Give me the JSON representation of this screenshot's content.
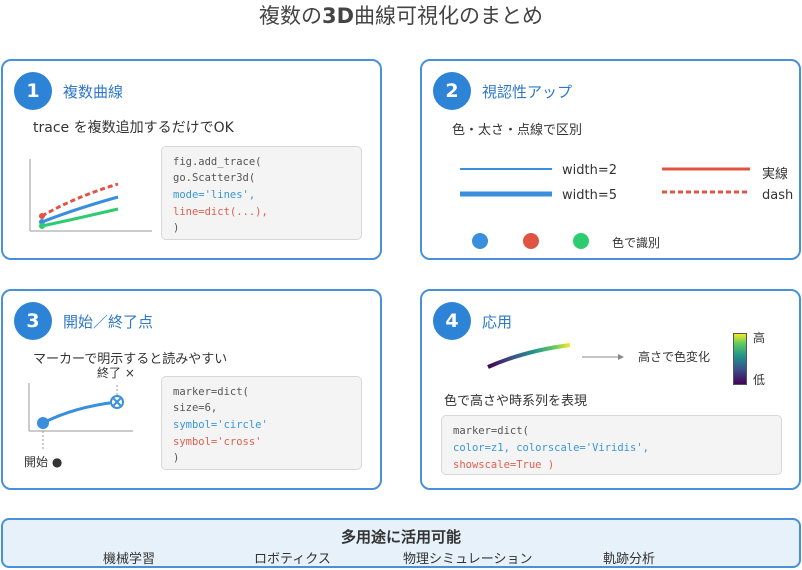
{
  "title_prefix": "複数の",
  "title_bold": "3D",
  "title_suffix": "曲線可視化のまとめ",
  "cards": [
    {
      "number": "1",
      "title": "複数曲線",
      "subtitle": "trace を複数追加するだけでOK",
      "code": [
        "fig.add_trace(",
        "  go.Scatter3d(",
        "    mode='lines',",
        "    line=dict(...),",
        "  )"
      ]
    },
    {
      "number": "2",
      "title": "視認性アップ",
      "subtitle": "色・太さ・点線で区別",
      "legend": {
        "width2": "width=2",
        "width5": "width=5",
        "solid": "実線",
        "dash": "dash",
        "color_note": "色で識別"
      },
      "colors": {
        "blue": "#3a8fdc",
        "red": "#e05444",
        "green": "#2ecc71"
      }
    },
    {
      "number": "3",
      "title": "開始／終了点",
      "subtitle": "マーカーで明示すると読みやすい",
      "end_label": "終了 ×",
      "start_label": "開始 ●",
      "code": [
        "marker=dict(",
        "  size=6,",
        "  symbol='circle'",
        "  symbol='cross'",
        ")"
      ]
    },
    {
      "number": "4",
      "title": "応用",
      "color_change": "高さで色変化",
      "high": "高",
      "low": "低",
      "subtitle": "色で高さや時系列を表現",
      "code": [
        "marker=dict(",
        "  color=z1, colorscale='Viridis',",
        "  showscale=True )"
      ]
    }
  ],
  "footer": {
    "title": "多用途に活用可能",
    "items": [
      "機械学習",
      "ロボティクス",
      "物理シミュレーション",
      "軌跡分析"
    ]
  }
}
